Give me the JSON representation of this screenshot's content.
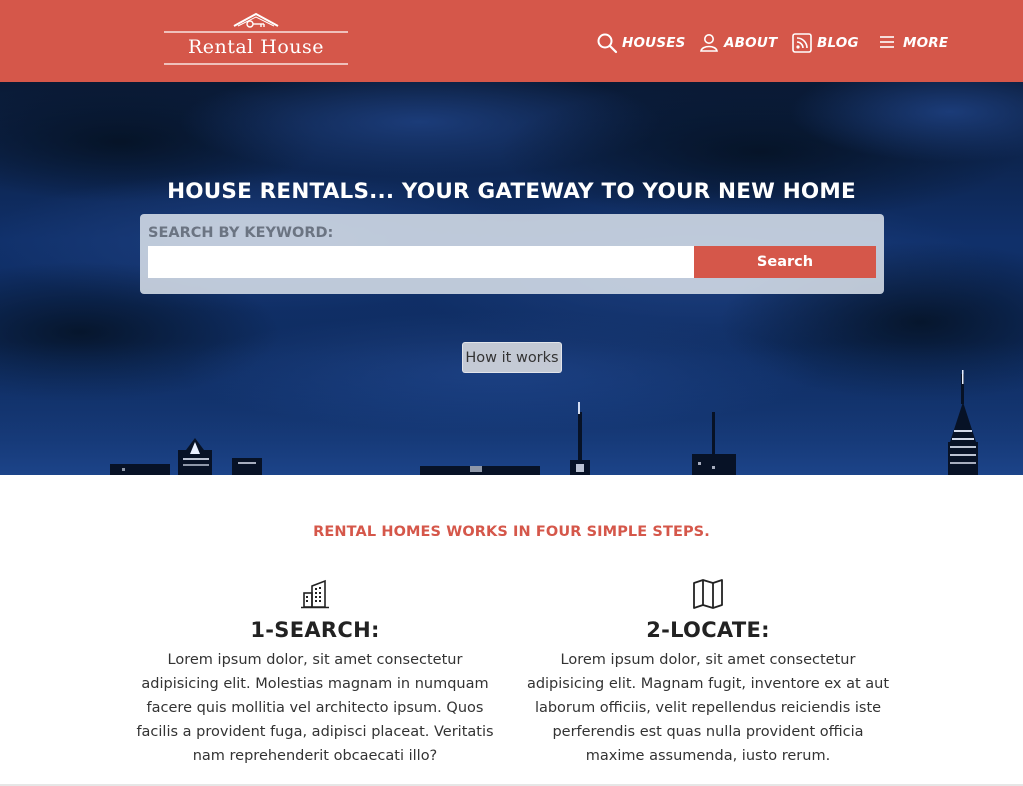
{
  "brand": {
    "name": "Rental House"
  },
  "nav": {
    "items": [
      {
        "label": "HOUSES",
        "icon": "search-icon"
      },
      {
        "label": "ABOUT",
        "icon": "user-icon"
      },
      {
        "label": "BLOG",
        "icon": "rss-icon"
      },
      {
        "label": "MORE",
        "icon": "menu-icon"
      }
    ]
  },
  "hero": {
    "title": "HOUSE RENTALS... YOUR GATEWAY TO YOUR NEW HOME",
    "search": {
      "label": "SEARCH BY KEYWORD:",
      "value": "",
      "placeholder": "",
      "button_label": "Search"
    },
    "how_it_works_label": "How it works"
  },
  "steps": {
    "heading": "RENTAL HOMES WORKS IN FOUR SIMPLE STEPS.",
    "items": [
      {
        "icon": "building-icon",
        "title": "1-SEARCH:",
        "text": "Lorem ipsum dolor, sit amet consectetur adipisicing elit. Molestias magnam in numquam facere quis mollitia vel architecto ipsum. Quos facilis a provident fuga, adipisci placeat. Veritatis nam reprehenderit obcaecati illo?"
      },
      {
        "icon": "map-icon",
        "title": "2-LOCATE:",
        "text": "Lorem ipsum dolor, sit amet consectetur adipisicing elit. Magnam fugit, inventore ex at aut laborum officiis, velit repellendus reiciendis iste perferendis est quas nulla provident officia maxime assumenda, iusto rerum."
      }
    ]
  },
  "colors": {
    "accent": "#d5574a",
    "hero_dark": "#0f2d62",
    "text": "#222222"
  }
}
